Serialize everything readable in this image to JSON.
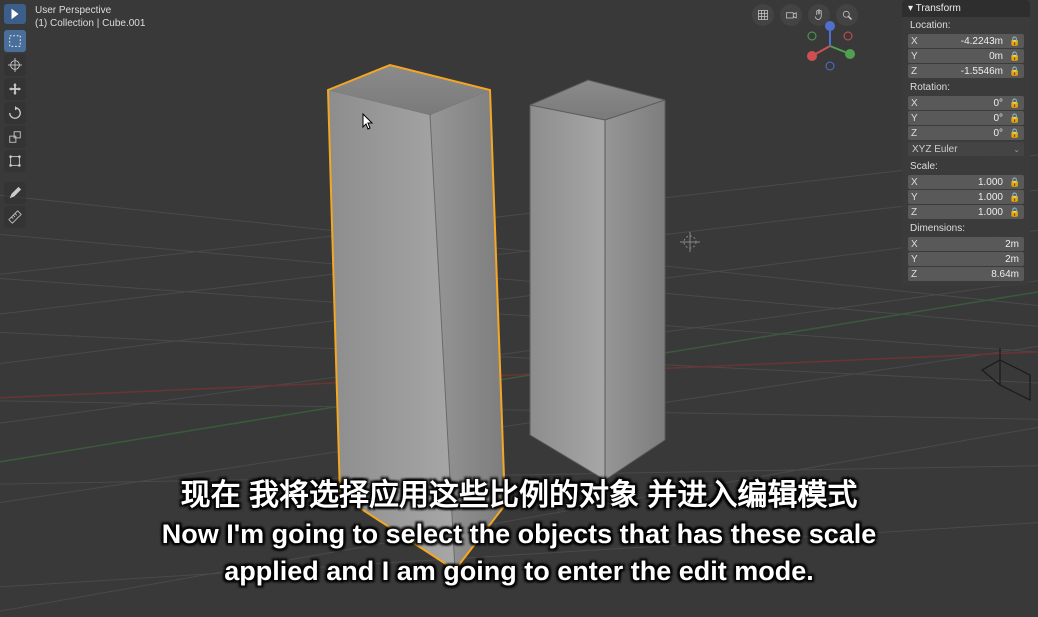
{
  "header": {
    "perspective_label": "User Perspective",
    "collection_label": "(1)  Collection | Cube.001"
  },
  "tools": {
    "cursor_icon": "cursor",
    "select_icon": "select-box",
    "move_icon": "move",
    "rotate_icon": "rotate",
    "scale_icon": "scale",
    "transform_icon": "transform",
    "annotate_icon": "annotate",
    "measure_icon": "measure"
  },
  "header_icons": {
    "grid": "grid",
    "camera": "camera",
    "hand": "pan",
    "zoom": "zoom"
  },
  "transform": {
    "title": "▾ Transform",
    "location_label": "Location:",
    "location": {
      "x": "-4.2243m",
      "y": "0m",
      "z": "-1.5546m"
    },
    "rotation_label": "Rotation:",
    "rotation": {
      "x": "0°",
      "y": "0°",
      "z": "0°"
    },
    "rotation_mode": "XYZ Euler",
    "scale_label": "Scale:",
    "scale": {
      "x": "1.000",
      "y": "1.000",
      "z": "1.000"
    },
    "dimensions_label": "Dimensions:",
    "dimensions": {
      "x": "2m",
      "y": "2m",
      "z": "8.64m"
    }
  },
  "axis_labels": {
    "x": "X",
    "y": "Y",
    "z": "Z"
  },
  "lock_glyph": "🔒",
  "subtitle_zh": "现在 我将选择应用这些比例的对象 并进入编辑模式",
  "subtitle_en_line1": "Now I'm going to select the objects that has these scale",
  "subtitle_en_line2": "applied and I am going to enter the edit mode."
}
